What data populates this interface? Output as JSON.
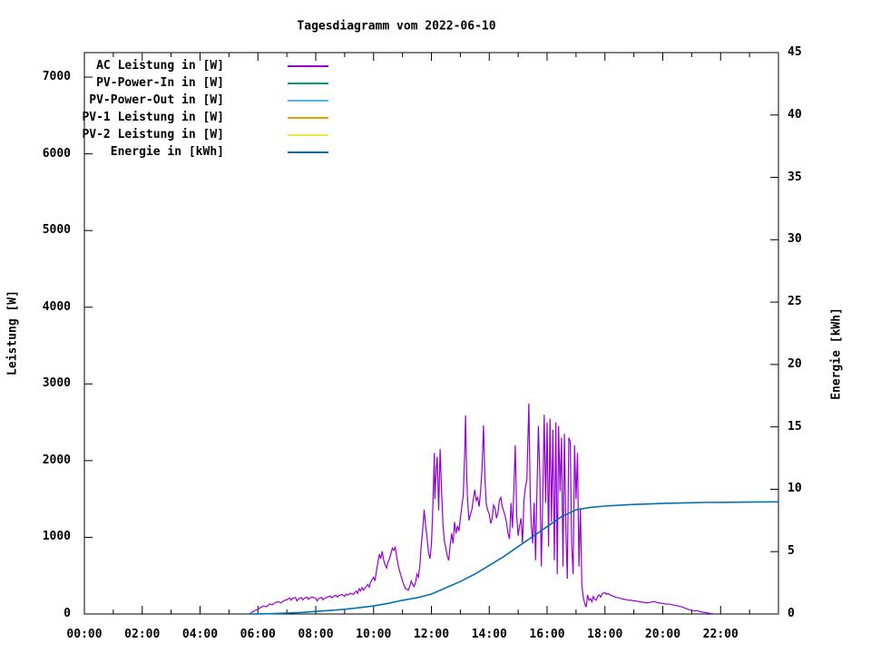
{
  "title": "Tagesdiagramm vom 2022-06-10",
  "chart_data": {
    "type": "line",
    "title": "Tagesdiagramm vom 2022-06-10",
    "background": "#ffffff",
    "border_color": "#000000",
    "grid": false,
    "legend_position": "top-left-inside",
    "x_axis": {
      "unit": "time",
      "range_hours": [
        0,
        24
      ],
      "major_tick_step_hours": 2,
      "minor_tick_step_hours": 1,
      "tick_labels": [
        "00:00",
        "02:00",
        "04:00",
        "06:00",
        "08:00",
        "10:00",
        "12:00",
        "14:00",
        "16:00",
        "18:00",
        "20:00",
        "22:00"
      ]
    },
    "y_left": {
      "label": "Leistung [W]",
      "range": [
        0,
        7320
      ],
      "ticks": [
        0,
        1000,
        2000,
        3000,
        4000,
        5000,
        6000,
        7000
      ]
    },
    "y_right": {
      "label": "Energie [kWh]",
      "range": [
        0,
        45
      ],
      "ticks": [
        0,
        5,
        10,
        15,
        20,
        25,
        30,
        35,
        40,
        45
      ]
    },
    "legend": [
      {
        "label": "AC Leistung in [W]",
        "color": "#9400d3"
      },
      {
        "label": "PV-Power-In in [W]",
        "color": "#009e73"
      },
      {
        "label": "PV-Power-Out in [W]",
        "color": "#56b4e9"
      },
      {
        "label": "PV-1 Leistung in [W]",
        "color": "#e69f00"
      },
      {
        "label": "PV-2 Leistung in [W]",
        "color": "#f0e442"
      },
      {
        "label": "Energie in [kWh]",
        "color": "#0072b2"
      }
    ],
    "series": [
      {
        "name": "AC Leistung in [W]",
        "axis": "left",
        "color": "#9400d3",
        "stroke_width": 1.2,
        "points": [
          [
            5.7,
            0
          ],
          [
            5.8,
            25
          ],
          [
            5.9,
            45
          ],
          [
            6.0,
            60
          ],
          [
            6.1,
            85
          ],
          [
            6.2,
            105
          ],
          [
            6.3,
            95
          ],
          [
            6.4,
            130
          ],
          [
            6.5,
            120
          ],
          [
            6.6,
            150
          ],
          [
            6.7,
            160
          ],
          [
            6.8,
            145
          ],
          [
            6.9,
            175
          ],
          [
            7.0,
            185
          ],
          [
            7.1,
            210
          ],
          [
            7.15,
            180
          ],
          [
            7.2,
            205
          ],
          [
            7.3,
            215
          ],
          [
            7.35,
            170
          ],
          [
            7.4,
            195
          ],
          [
            7.5,
            215
          ],
          [
            7.55,
            185
          ],
          [
            7.6,
            205
          ],
          [
            7.7,
            220
          ],
          [
            7.75,
            190
          ],
          [
            7.8,
            210
          ],
          [
            7.9,
            220
          ],
          [
            8.0,
            205
          ],
          [
            8.05,
            170
          ],
          [
            8.1,
            200
          ],
          [
            8.2,
            215
          ],
          [
            8.25,
            185
          ],
          [
            8.3,
            205
          ],
          [
            8.4,
            220
          ],
          [
            8.5,
            235
          ],
          [
            8.55,
            210
          ],
          [
            8.6,
            225
          ],
          [
            8.7,
            245
          ],
          [
            8.75,
            220
          ],
          [
            8.8,
            240
          ],
          [
            8.9,
            255
          ],
          [
            9.0,
            230
          ],
          [
            9.05,
            260
          ],
          [
            9.1,
            245
          ],
          [
            9.2,
            270
          ],
          [
            9.3,
            255
          ],
          [
            9.4,
            300
          ],
          [
            9.45,
            270
          ],
          [
            9.5,
            330
          ],
          [
            9.55,
            300
          ],
          [
            9.6,
            345
          ],
          [
            9.65,
            310
          ],
          [
            9.7,
            340
          ],
          [
            9.8,
            385
          ],
          [
            9.85,
            350
          ],
          [
            9.9,
            420
          ],
          [
            10.0,
            480
          ],
          [
            10.05,
            430
          ],
          [
            10.1,
            560
          ],
          [
            10.2,
            780
          ],
          [
            10.25,
            720
          ],
          [
            10.3,
            820
          ],
          [
            10.35,
            700
          ],
          [
            10.4,
            640
          ],
          [
            10.45,
            600
          ],
          [
            10.5,
            680
          ],
          [
            10.55,
            720
          ],
          [
            10.6,
            790
          ],
          [
            10.65,
            860
          ],
          [
            10.7,
            830
          ],
          [
            10.75,
            870
          ],
          [
            10.8,
            740
          ],
          [
            10.85,
            640
          ],
          [
            10.9,
            560
          ],
          [
            11.0,
            430
          ],
          [
            11.05,
            380
          ],
          [
            11.1,
            335
          ],
          [
            11.2,
            310
          ],
          [
            11.25,
            360
          ],
          [
            11.3,
            430
          ],
          [
            11.35,
            385
          ],
          [
            11.4,
            360
          ],
          [
            11.45,
            410
          ],
          [
            11.5,
            520
          ],
          [
            11.55,
            480
          ],
          [
            11.6,
            640
          ],
          [
            11.65,
            900
          ],
          [
            11.7,
            1100
          ],
          [
            11.75,
            1360
          ],
          [
            11.8,
            1150
          ],
          [
            11.85,
            1000
          ],
          [
            11.9,
            800
          ],
          [
            11.95,
            720
          ],
          [
            12.0,
            900
          ],
          [
            12.05,
            1400
          ],
          [
            12.1,
            2100
          ],
          [
            12.12,
            1500
          ],
          [
            12.17,
            1900
          ],
          [
            12.2,
            2050
          ],
          [
            12.25,
            1350
          ],
          [
            12.3,
            2150
          ],
          [
            12.35,
            1600
          ],
          [
            12.4,
            1150
          ],
          [
            12.45,
            950
          ],
          [
            12.5,
            860
          ],
          [
            12.55,
            750
          ],
          [
            12.6,
            700
          ],
          [
            12.65,
            900
          ],
          [
            12.7,
            1050
          ],
          [
            12.75,
            920
          ],
          [
            12.8,
            1200
          ],
          [
            12.85,
            1050
          ],
          [
            12.9,
            1150
          ],
          [
            12.95,
            1080
          ],
          [
            13.0,
            1250
          ],
          [
            13.05,
            1400
          ],
          [
            13.1,
            1550
          ],
          [
            13.15,
            2100
          ],
          [
            13.18,
            2590
          ],
          [
            13.22,
            1800
          ],
          [
            13.25,
            1500
          ],
          [
            13.3,
            1220
          ],
          [
            13.35,
            1300
          ],
          [
            13.4,
            1360
          ],
          [
            13.45,
            1500
          ],
          [
            13.5,
            1620
          ],
          [
            13.55,
            1480
          ],
          [
            13.6,
            1520
          ],
          [
            13.65,
            1400
          ],
          [
            13.7,
            1600
          ],
          [
            13.75,
            1900
          ],
          [
            13.8,
            2460
          ],
          [
            13.85,
            1750
          ],
          [
            13.9,
            1420
          ],
          [
            13.95,
            1350
          ],
          [
            14.0,
            1300
          ],
          [
            14.05,
            1180
          ],
          [
            14.1,
            1240
          ],
          [
            14.15,
            1420
          ],
          [
            14.2,
            1380
          ],
          [
            14.25,
            1250
          ],
          [
            14.3,
            1320
          ],
          [
            14.35,
            1480
          ],
          [
            14.4,
            1520
          ],
          [
            14.45,
            1400
          ],
          [
            14.5,
            1340
          ],
          [
            14.55,
            1280
          ],
          [
            14.6,
            1180
          ],
          [
            14.65,
            1050
          ],
          [
            14.7,
            980
          ],
          [
            14.75,
            1450
          ],
          [
            14.8,
            1120
          ],
          [
            14.85,
            1600
          ],
          [
            14.9,
            2200
          ],
          [
            14.95,
            1280
          ],
          [
            15.0,
            1020
          ],
          [
            15.05,
            1150
          ],
          [
            15.1,
            1250
          ],
          [
            15.15,
            920
          ],
          [
            15.2,
            1480
          ],
          [
            15.25,
            1650
          ],
          [
            15.3,
            1750
          ],
          [
            15.37,
            2745
          ],
          [
            15.42,
            1500
          ],
          [
            15.45,
            1180
          ],
          [
            15.5,
            920
          ],
          [
            15.55,
            1450
          ],
          [
            15.6,
            700
          ],
          [
            15.65,
            1600
          ],
          [
            15.7,
            2450
          ],
          [
            15.75,
            1800
          ],
          [
            15.8,
            620
          ],
          [
            15.85,
            1500
          ],
          [
            15.9,
            2600
          ],
          [
            15.95,
            1450
          ],
          [
            16.0,
            2500
          ],
          [
            16.05,
            880
          ],
          [
            16.1,
            2550
          ],
          [
            16.15,
            1200
          ],
          [
            16.2,
            2400
          ],
          [
            16.25,
            700
          ],
          [
            16.3,
            2500
          ],
          [
            16.35,
            520
          ],
          [
            16.4,
            2450
          ],
          [
            16.45,
            1600
          ],
          [
            16.5,
            2300
          ],
          [
            16.55,
            620
          ],
          [
            16.6,
            2350
          ],
          [
            16.65,
            1100
          ],
          [
            16.7,
            460
          ],
          [
            16.75,
            2300
          ],
          [
            16.8,
            2250
          ],
          [
            16.85,
            900
          ],
          [
            16.9,
            520
          ],
          [
            16.95,
            2200
          ],
          [
            17.0,
            1500
          ],
          [
            17.05,
            2100
          ],
          [
            17.1,
            620
          ],
          [
            17.15,
            1380
          ],
          [
            17.2,
            380
          ],
          [
            17.25,
            220
          ],
          [
            17.3,
            140
          ],
          [
            17.35,
            90
          ],
          [
            17.4,
            250
          ],
          [
            17.45,
            180
          ],
          [
            17.5,
            200
          ],
          [
            17.55,
            160
          ],
          [
            17.6,
            230
          ],
          [
            17.65,
            190
          ],
          [
            17.7,
            180
          ],
          [
            17.75,
            230
          ],
          [
            17.8,
            250
          ],
          [
            17.85,
            220
          ],
          [
            17.9,
            265
          ],
          [
            18.0,
            280
          ],
          [
            18.05,
            255
          ],
          [
            18.1,
            270
          ],
          [
            18.2,
            245
          ],
          [
            18.3,
            230
          ],
          [
            18.4,
            215
          ],
          [
            18.5,
            210
          ],
          [
            18.6,
            195
          ],
          [
            18.7,
            190
          ],
          [
            18.8,
            180
          ],
          [
            18.9,
            178
          ],
          [
            19.0,
            172
          ],
          [
            19.1,
            168
          ],
          [
            19.2,
            160
          ],
          [
            19.3,
            155
          ],
          [
            19.4,
            148
          ],
          [
            19.5,
            145
          ],
          [
            19.6,
            155
          ],
          [
            19.7,
            162
          ],
          [
            19.8,
            150
          ],
          [
            19.9,
            142
          ],
          [
            20.0,
            138
          ],
          [
            20.1,
            128
          ],
          [
            20.2,
            132
          ],
          [
            20.3,
            122
          ],
          [
            20.4,
            115
          ],
          [
            20.5,
            108
          ],
          [
            20.6,
            98
          ],
          [
            20.7,
            88
          ],
          [
            20.8,
            72
          ],
          [
            20.9,
            58
          ],
          [
            21.0,
            48
          ],
          [
            21.1,
            40
          ],
          [
            21.2,
            45
          ],
          [
            21.3,
            30
          ],
          [
            21.4,
            22
          ],
          [
            21.5,
            18
          ],
          [
            21.6,
            10
          ],
          [
            21.7,
            6
          ],
          [
            21.75,
            0
          ]
        ]
      },
      {
        "name": "Energie in [kWh]",
        "axis": "right",
        "color": "#0072b2",
        "stroke_width": 1.6,
        "points": [
          [
            5.7,
            0
          ],
          [
            6.0,
            0.01
          ],
          [
            6.5,
            0.03
          ],
          [
            7.0,
            0.07
          ],
          [
            7.5,
            0.12
          ],
          [
            8.0,
            0.2
          ],
          [
            8.5,
            0.28
          ],
          [
            9.0,
            0.38
          ],
          [
            9.5,
            0.5
          ],
          [
            10.0,
            0.65
          ],
          [
            10.5,
            0.85
          ],
          [
            11.0,
            1.1
          ],
          [
            11.5,
            1.3
          ],
          [
            12.0,
            1.6
          ],
          [
            12.5,
            2.1
          ],
          [
            13.0,
            2.6
          ],
          [
            13.5,
            3.2
          ],
          [
            14.0,
            3.9
          ],
          [
            14.5,
            4.6
          ],
          [
            15.0,
            5.4
          ],
          [
            15.5,
            6.2
          ],
          [
            16.0,
            7.0
          ],
          [
            16.5,
            7.8
          ],
          [
            17.0,
            8.35
          ],
          [
            17.5,
            8.55
          ],
          [
            18.0,
            8.65
          ],
          [
            18.5,
            8.72
          ],
          [
            19.0,
            8.78
          ],
          [
            19.5,
            8.82
          ],
          [
            20.0,
            8.86
          ],
          [
            20.5,
            8.89
          ],
          [
            21.0,
            8.92
          ],
          [
            21.5,
            8.94
          ],
          [
            22.0,
            8.95
          ],
          [
            23.0,
            8.97
          ],
          [
            24.0,
            8.99
          ]
        ]
      }
    ]
  }
}
